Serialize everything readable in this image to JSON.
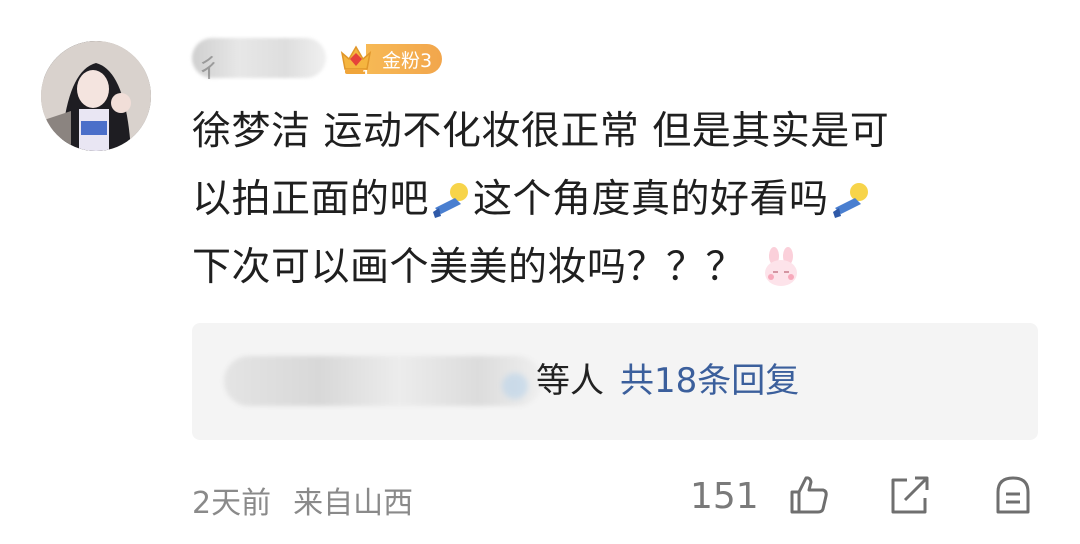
{
  "comment": {
    "fan_badge": "金粉3",
    "lines": [
      "徐梦洁 运动不化妆很正常 但是其实是可",
      "以拍正面的吧",
      "这个角度真的好看吗",
      "下次可以画个美美的妆吗？？？"
    ],
    "emoji_names": [
      "lying-doll-emoji",
      "lying-doll-emoji",
      "bunny-emoji"
    ]
  },
  "replies": {
    "others_suffix": "等人",
    "link_text": "共18条回复"
  },
  "footer": {
    "time": "2天前",
    "location": "来自山西",
    "like_count": "151"
  },
  "colors": {
    "link": "#3b5f9c",
    "badge": "#f2a64c",
    "meta": "#8a8a8a"
  }
}
